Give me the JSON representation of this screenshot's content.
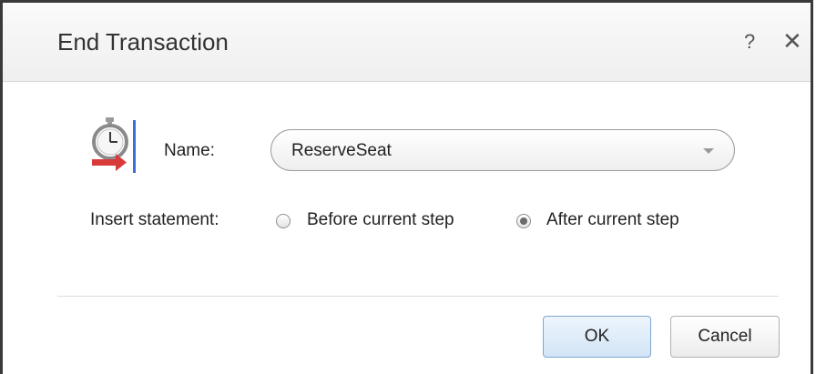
{
  "dialog": {
    "title": "End Transaction",
    "help_label": "?",
    "close_label": "✕"
  },
  "form": {
    "name_label": "Name:",
    "name_value": "ReserveSeat",
    "insert_label": "Insert statement:",
    "options": [
      {
        "label": "Before current step",
        "selected": false
      },
      {
        "label": "After current step",
        "selected": true
      }
    ]
  },
  "buttons": {
    "ok_label": "OK",
    "cancel_label": "Cancel"
  },
  "icons": {
    "transaction": "end-transaction-stopwatch-icon",
    "dropdown": "chevron-down-icon",
    "help": "help-icon",
    "close": "close-icon"
  },
  "colors": {
    "accent": "#3b6ed6",
    "arrow": "#d83a3a",
    "ok_border": "#7fa7cf"
  }
}
